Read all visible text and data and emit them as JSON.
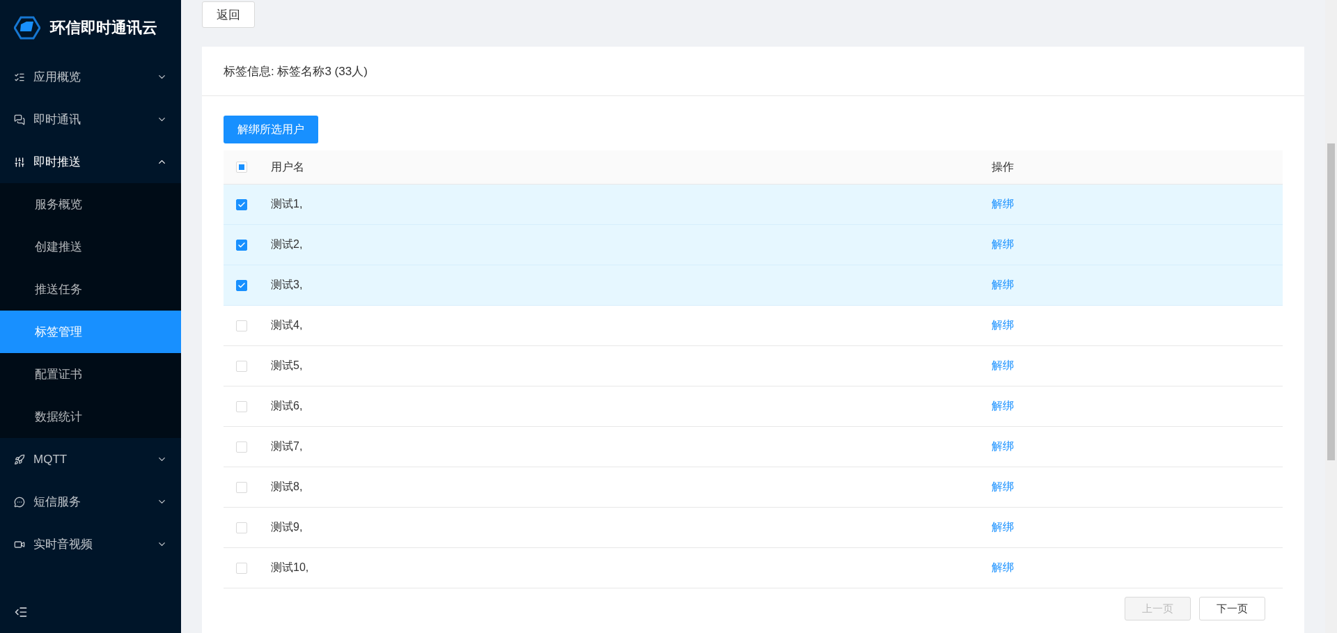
{
  "sidebar": {
    "brand": "环信即时通讯云",
    "items": [
      {
        "kind": "group",
        "label": "应用概览",
        "expanded": false
      },
      {
        "kind": "group",
        "label": "即时通讯",
        "expanded": false
      },
      {
        "kind": "group",
        "label": "即时推送",
        "expanded": true,
        "children": [
          {
            "label": "服务概览",
            "selected": false
          },
          {
            "label": "创建推送",
            "selected": false
          },
          {
            "label": "推送任务",
            "selected": false
          },
          {
            "label": "标签管理",
            "selected": true
          },
          {
            "label": "配置证书",
            "selected": false
          },
          {
            "label": "数据统计",
            "selected": false
          }
        ]
      },
      {
        "kind": "group",
        "label": "MQTT",
        "expanded": false
      },
      {
        "kind": "group",
        "label": "短信服务",
        "expanded": false
      },
      {
        "kind": "group",
        "label": "实时音视频",
        "expanded": false
      }
    ]
  },
  "back_button": "返回",
  "card": {
    "title": "标签信息: 标签名称3 (33人)",
    "unbind_selected_button": "解绑所选用户",
    "table": {
      "select_all": {
        "checked": false,
        "indeterminate": true
      },
      "columns": [
        "用户名",
        "操作"
      ],
      "rows": [
        {
          "username": "测试1,",
          "action": "解绑",
          "checked": true
        },
        {
          "username": "测试2,",
          "action": "解绑",
          "checked": true
        },
        {
          "username": "测试3,",
          "action": "解绑",
          "checked": true
        },
        {
          "username": "测试4,",
          "action": "解绑",
          "checked": false
        },
        {
          "username": "测试5,",
          "action": "解绑",
          "checked": false
        },
        {
          "username": "测试6,",
          "action": "解绑",
          "checked": false
        },
        {
          "username": "测试7,",
          "action": "解绑",
          "checked": false
        },
        {
          "username": "测试8,",
          "action": "解绑",
          "checked": false
        },
        {
          "username": "测试9,",
          "action": "解绑",
          "checked": false
        },
        {
          "username": "测试10,",
          "action": "解绑",
          "checked": false
        }
      ]
    },
    "pagination": [
      {
        "label": "上一页",
        "disabled": true
      },
      {
        "label": "下一页",
        "disabled": false
      }
    ]
  }
}
